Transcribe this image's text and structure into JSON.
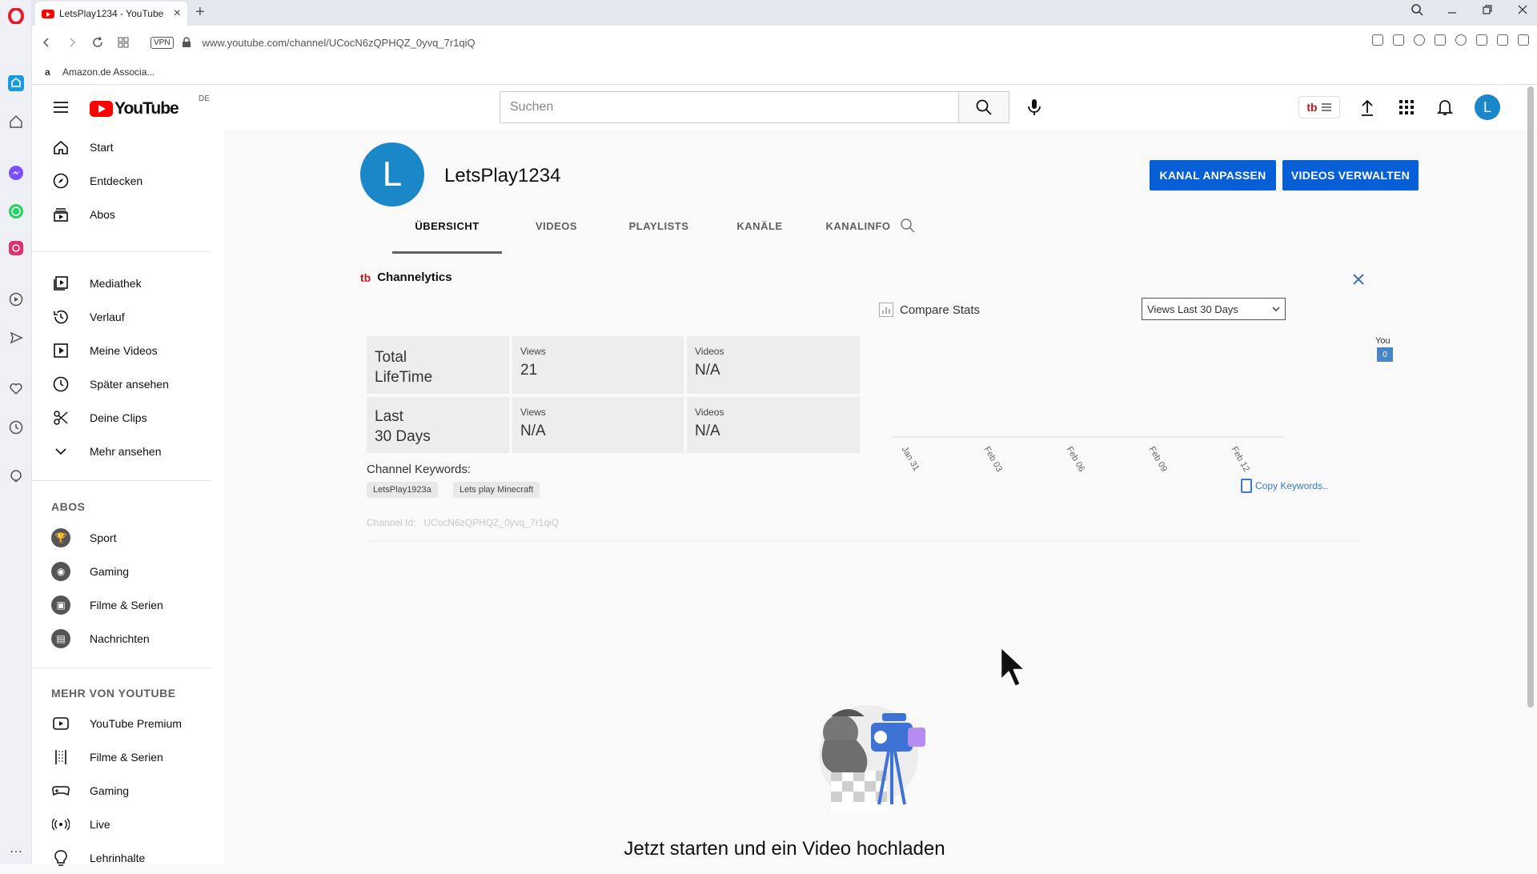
{
  "browser": {
    "tab_title": "LetsPlay1234 - YouTube",
    "url": "www.youtube.com/channel/UCocN6zQPHQZ_0yvq_7r1qiQ",
    "vpn_label": "VPN",
    "bookmark": "Amazon.de Associa..."
  },
  "header": {
    "logo_text": "YouTube",
    "country": "DE",
    "search_placeholder": "Suchen",
    "ext_badge": "tb",
    "avatar_letter": "L"
  },
  "sidebar": {
    "main": [
      {
        "label": "Start",
        "icon": "home-icon"
      },
      {
        "label": "Entdecken",
        "icon": "compass-icon"
      },
      {
        "label": "Abos",
        "icon": "subscriptions-icon"
      }
    ],
    "library": [
      {
        "label": "Mediathek",
        "icon": "library-icon"
      },
      {
        "label": "Verlauf",
        "icon": "history-icon"
      },
      {
        "label": "Meine Videos",
        "icon": "my-videos-icon"
      },
      {
        "label": "Später ansehen",
        "icon": "watch-later-icon"
      },
      {
        "label": "Deine Clips",
        "icon": "scissors-icon"
      },
      {
        "label": "Mehr ansehen",
        "icon": "chevron-down-icon"
      }
    ],
    "abos_heading": "ABOS",
    "abos": [
      {
        "label": "Sport"
      },
      {
        "label": "Gaming"
      },
      {
        "label": "Filme & Serien"
      },
      {
        "label": "Nachrichten"
      }
    ],
    "more_heading": "MEHR VON YOUTUBE",
    "more": [
      {
        "label": "YouTube Premium",
        "icon": "youtube-premium-icon"
      },
      {
        "label": "Filme & Serien",
        "icon": "film-icon"
      },
      {
        "label": "Gaming",
        "icon": "gamepad-icon"
      },
      {
        "label": "Live",
        "icon": "live-icon"
      },
      {
        "label": "Lehrinhalte",
        "icon": "lightbulb-icon"
      }
    ]
  },
  "channel": {
    "avatar_letter": "L",
    "name": "LetsPlay1234",
    "btn_customize": "KANAL ANPASSEN",
    "btn_manage": "VIDEOS VERWALTEN",
    "tabs": [
      "ÜBERSICHT",
      "VIDEOS",
      "PLAYLISTS",
      "KANÄLE",
      "KANALINFO"
    ]
  },
  "channelytics": {
    "brand_logo": "tb",
    "title": "Channelytics",
    "compare_stats": "Compare Stats",
    "views_select": "Views Last 30 Days",
    "total_label": "Total",
    "total_label2": "LifeTime",
    "last_label": "Last",
    "last_label2": "30 Days",
    "views_label": "Views",
    "videos_label": "Videos",
    "total_views": "21",
    "total_videos": "N/A",
    "last_views": "N/A",
    "last_videos": "N/A",
    "chart_you": "You",
    "chart_you_value": "0",
    "chart_ticks": [
      "Jan 31",
      "Feb 03",
      "Feb 06",
      "Feb 09",
      "Feb 12"
    ],
    "keywords_label": "Channel Keywords:",
    "keywords": [
      "LetsPlay1923a",
      "Lets play Minecraft"
    ],
    "copy_keywords": "Copy Keywords..",
    "channel_id_label": "Channel Id:",
    "channel_id": "UCocN6zQPHQZ_0yvq_7r1qiQ"
  },
  "empty_state": {
    "title": "Jetzt starten und ein Video hochladen"
  },
  "colors": {
    "accent_blue": "#065fd4",
    "avatar_blue": "#1a87c9",
    "brand_red": "#ff0000",
    "tb_red": "#c4161c"
  }
}
